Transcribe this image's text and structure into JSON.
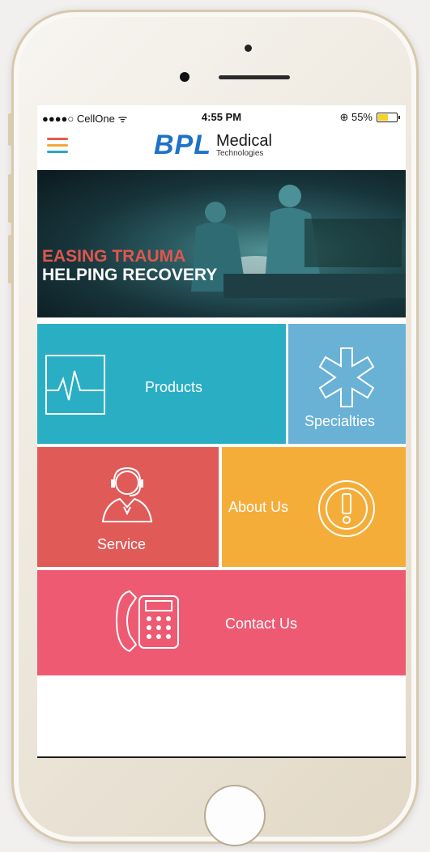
{
  "status_bar": {
    "carrier": "●●●●○ CellOne ᯤ",
    "time": "4:55 PM",
    "battery_text": "⊕ 55%"
  },
  "header": {
    "logo_bpl": "BPL",
    "logo_medical": "Medical",
    "logo_technologies": "Technologies",
    "menu_colors": [
      "#e95a4a",
      "#f2a83a",
      "#2aa7c0"
    ]
  },
  "hero": {
    "line1": "EASING TRAUMA",
    "line2": "HELPING RECOVERY"
  },
  "tiles": {
    "products": "Products",
    "specialties": "Specialties",
    "service": "Service",
    "about_us": "About Us",
    "contact_us": "Contact Us"
  },
  "icons": {
    "products": "heartbeat-monitor-icon",
    "specialties": "asterisk-icon",
    "service": "support-agent-icon",
    "about_us": "exclamation-badge-icon",
    "contact_us": "phone-keypad-icon"
  },
  "colors": {
    "products": "#2aaec4",
    "specialties": "#6ab1d6",
    "service": "#e05a58",
    "about_us": "#f5ad3a",
    "contact_us": "#ee5a72",
    "brand": "#1e73c9"
  }
}
